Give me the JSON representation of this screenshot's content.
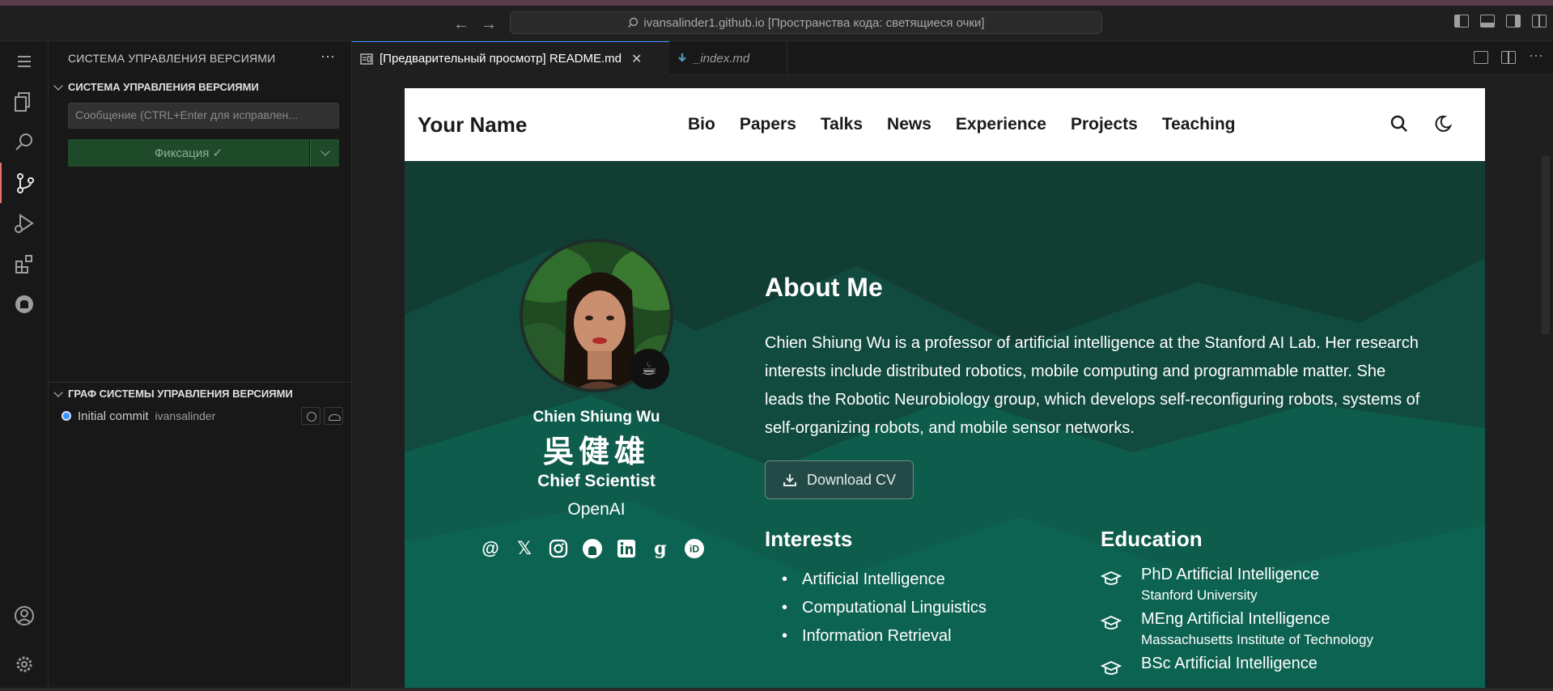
{
  "titlebar": {
    "back_icon": "arrow-left-icon",
    "forward_icon": "arrow-right-icon",
    "command_center": "ivansalinder1.github.io [Пространства кода: светящиеся очки]"
  },
  "sidebar": {
    "title": "СИСТЕМА УПРАВЛЕНИЯ ВЕРСИЯМИ",
    "section_title": "СИСТЕМА УПРАВЛЕНИЯ ВЕРСИЯМИ",
    "message_placeholder": "Сообщение (CTRL+Enter для исправлен...",
    "commit_button": "Фиксация ✓",
    "graph_title": "ГРАФ СИСТЕМЫ УПРАВЛЕНИЯ ВЕРСИЯМИ",
    "graph_commit": "Initial commit",
    "graph_author": "ivansalinder"
  },
  "tabs": [
    {
      "label": "[Предварительный просмотр] README.md",
      "active": true
    },
    {
      "label": "_index.md",
      "active": false
    }
  ],
  "site": {
    "brand": "Your Name",
    "nav": [
      "Bio",
      "Papers",
      "Talks",
      "News",
      "Experience",
      "Projects",
      "Teaching"
    ],
    "person_name": "Chien Shiung Wu",
    "person_cn": "吳健雄",
    "person_title": "Chief Scientist",
    "person_org": "OpenAI",
    "socials": [
      "at-icon",
      "x-icon",
      "instagram-icon",
      "github-icon",
      "linkedin-icon",
      "google-scholar-icon",
      "orcid-icon"
    ],
    "about_heading": "About Me",
    "about_text": "Chien Shiung Wu is a professor of artificial intelligence at the Stanford AI Lab. Her research interests include distributed robotics, mobile computing and programmable matter. She leads the Robotic Neurobiology group, which develops self-reconfiguring robots, systems of self-organizing robots, and mobile sensor networks.",
    "cv_button": "Download CV",
    "interests_heading": "Interests",
    "interests": [
      "Artificial Intelligence",
      "Computational Linguistics",
      "Information Retrieval"
    ],
    "education_heading": "Education",
    "education": [
      {
        "degree": "PhD Artificial Intelligence",
        "institution": "Stanford University"
      },
      {
        "degree": "MEng Artificial Intelligence",
        "institution": "Massachusetts Institute of Technology"
      },
      {
        "degree": "BSc Artificial Intelligence",
        "institution": ""
      }
    ]
  },
  "colors": {
    "accent": "#3794ff",
    "hero_green": "#0f5a49",
    "commit_green": "#1e4a2a",
    "active_indicator": "#e66f6f"
  }
}
